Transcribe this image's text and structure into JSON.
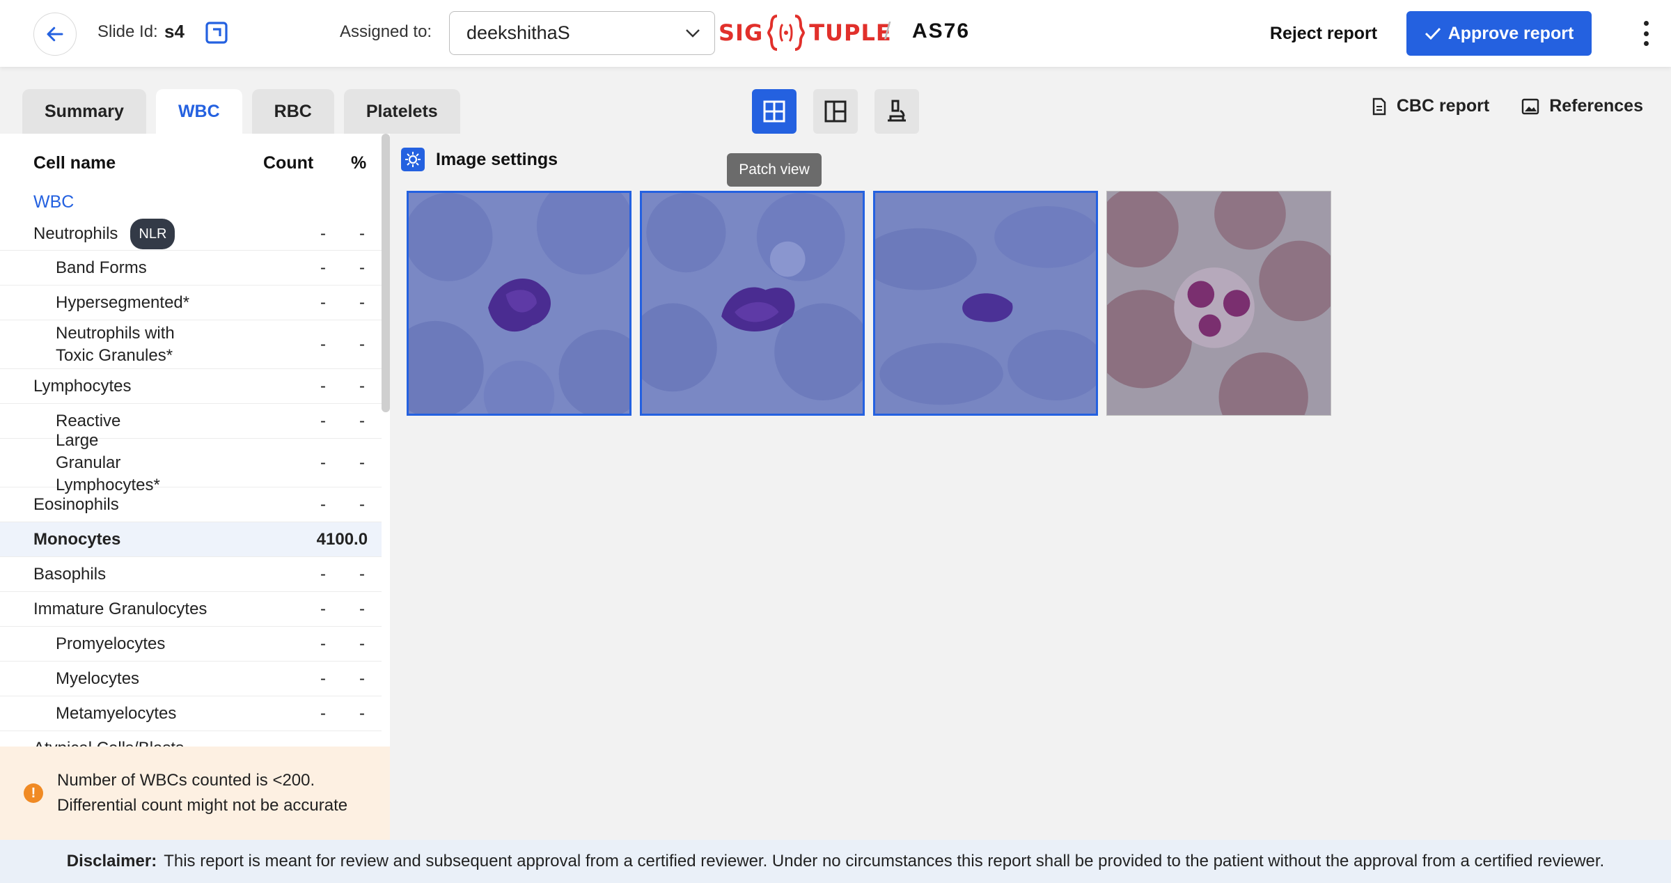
{
  "header": {
    "slide_label": "Slide Id:",
    "slide_id": "s4",
    "assigned_label": "Assigned to:",
    "assignee": "deekshithaS",
    "brand_left": "SIG",
    "brand_right": "TUPLE",
    "model": "AS76",
    "reject_label": "Reject report",
    "approve_label": "Approve report"
  },
  "tabs": [
    {
      "label": "Summary",
      "active": false
    },
    {
      "label": "WBC",
      "active": true
    },
    {
      "label": "RBC",
      "active": false
    },
    {
      "label": "Platelets",
      "active": false
    }
  ],
  "views": {
    "tooltip": "Patch view",
    "items": [
      {
        "icon": "grid-view-icon",
        "active": true
      },
      {
        "icon": "split-view-icon",
        "active": false
      },
      {
        "icon": "microscope-icon",
        "active": false
      }
    ]
  },
  "links": {
    "cbc": "CBC report",
    "references": "References"
  },
  "table": {
    "headers": {
      "name": "Cell name",
      "count": "Count",
      "pct": "%"
    },
    "group": "WBC",
    "rows": [
      {
        "name": "Neutrophils",
        "count": "-",
        "pct": "-",
        "badge": "NLR"
      },
      {
        "name": "Band Forms",
        "count": "-",
        "pct": "-",
        "sub": true
      },
      {
        "name": "Hypersegmented*",
        "count": "-",
        "pct": "-",
        "sub": true
      },
      {
        "name": "Neutrophils with Toxic Granules*",
        "count": "-",
        "pct": "-",
        "sub": true
      },
      {
        "name": "Lymphocytes",
        "count": "-",
        "pct": "-"
      },
      {
        "name": "Reactive",
        "count": "-",
        "pct": "-",
        "sub": true
      },
      {
        "name": "Large Granular Lymphocytes*",
        "count": "-",
        "pct": "-",
        "sub": true
      },
      {
        "name": "Eosinophils",
        "count": "-",
        "pct": "-"
      },
      {
        "name": "Monocytes",
        "count": "4",
        "pct": "100.0",
        "highlight": true
      },
      {
        "name": "Basophils",
        "count": "-",
        "pct": "-"
      },
      {
        "name": "Immature Granulocytes",
        "count": "-",
        "pct": "-"
      },
      {
        "name": "Promyelocytes",
        "count": "-",
        "pct": "-",
        "sub": true
      },
      {
        "name": "Myelocytes",
        "count": "-",
        "pct": "-",
        "sub": true
      },
      {
        "name": "Metamyelocytes",
        "count": "-",
        "pct": "-",
        "sub": true
      },
      {
        "name": "Atypical Cells/Blasts",
        "count": "-",
        "pct": "-"
      }
    ]
  },
  "warning": {
    "line1": "Number of WBCs counted is <200.",
    "line2": "Differential count might not be accurate"
  },
  "image_settings_label": "Image settings",
  "patches": [
    {
      "selected": true,
      "tone": "blue"
    },
    {
      "selected": true,
      "tone": "blue"
    },
    {
      "selected": true,
      "tone": "blue"
    },
    {
      "selected": false,
      "tone": "natural"
    }
  ],
  "footer": {
    "label": "Disclaimer:",
    "text": "This report is meant for review and subsequent approval from a certified reviewer. Under no circumstances this report shall be provided to the patient without the approval from a certified reviewer."
  },
  "colors": {
    "accent": "#2461e0",
    "brand": "#e1302b",
    "warning": "#f08a24"
  }
}
